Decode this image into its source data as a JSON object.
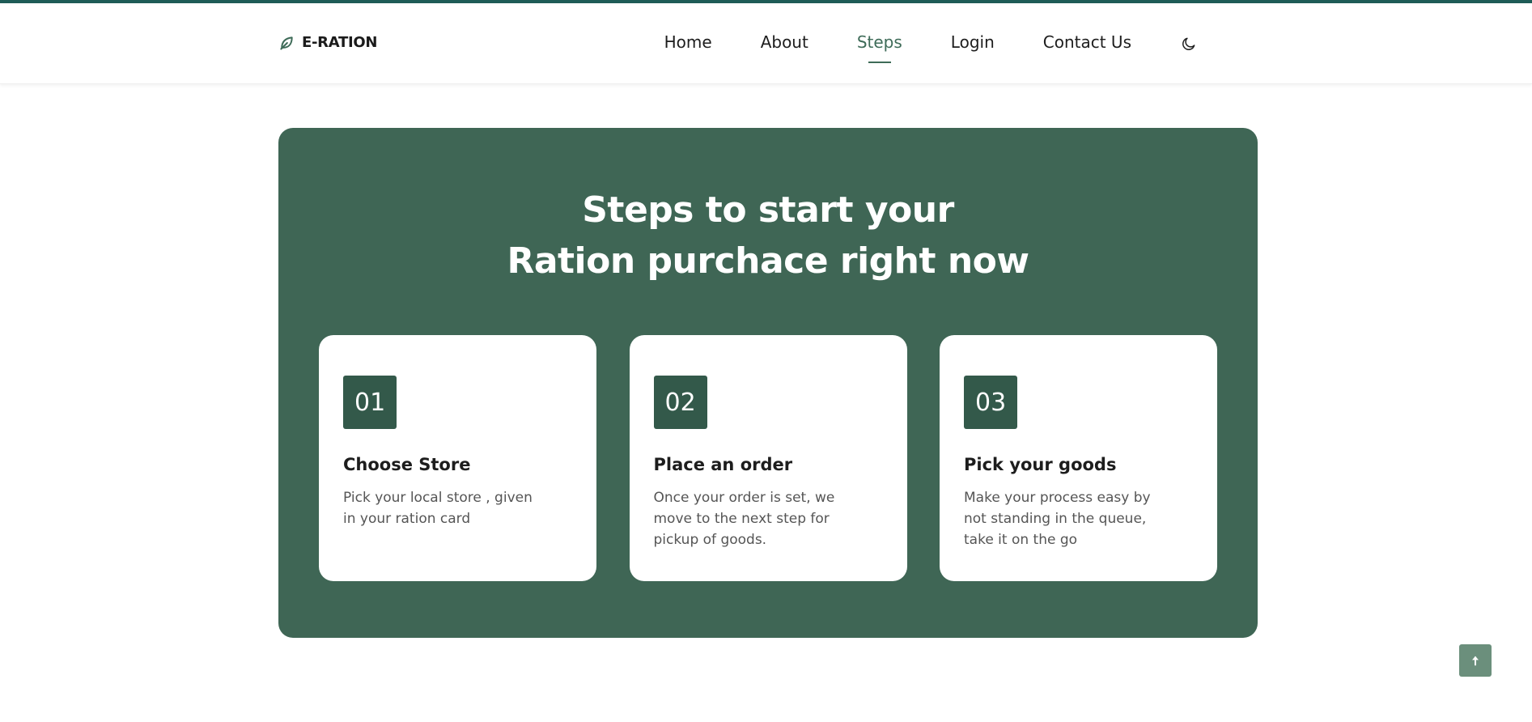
{
  "header": {
    "logo_text": "E-RATION",
    "nav": [
      {
        "label": "Home"
      },
      {
        "label": "About"
      },
      {
        "label": "Steps"
      },
      {
        "label": "Login"
      },
      {
        "label": "Contact Us"
      }
    ],
    "active_nav": "Steps"
  },
  "steps": {
    "title_line1": "Steps to start your",
    "title_line2": "Ration purchace right now",
    "cards": [
      {
        "number": "01",
        "title": "Choose Store",
        "description": "Pick your local store , given in your ration card"
      },
      {
        "number": "02",
        "title": "Place an order",
        "description": "Once your order is set, we move to the next step for pickup of goods."
      },
      {
        "number": "03",
        "title": "Pick your goods",
        "description": "Make your process easy by not standing in the queue, take it on the go"
      }
    ]
  },
  "icons": {
    "logo": "leaf-icon",
    "theme_toggle": "moon-icon",
    "scroll_top": "arrow-up-icon"
  },
  "colors": {
    "accent": "#3f6655",
    "badge": "#33594a",
    "top_bar": "#1e5c57",
    "scroll_button": "#6b8f7c"
  }
}
